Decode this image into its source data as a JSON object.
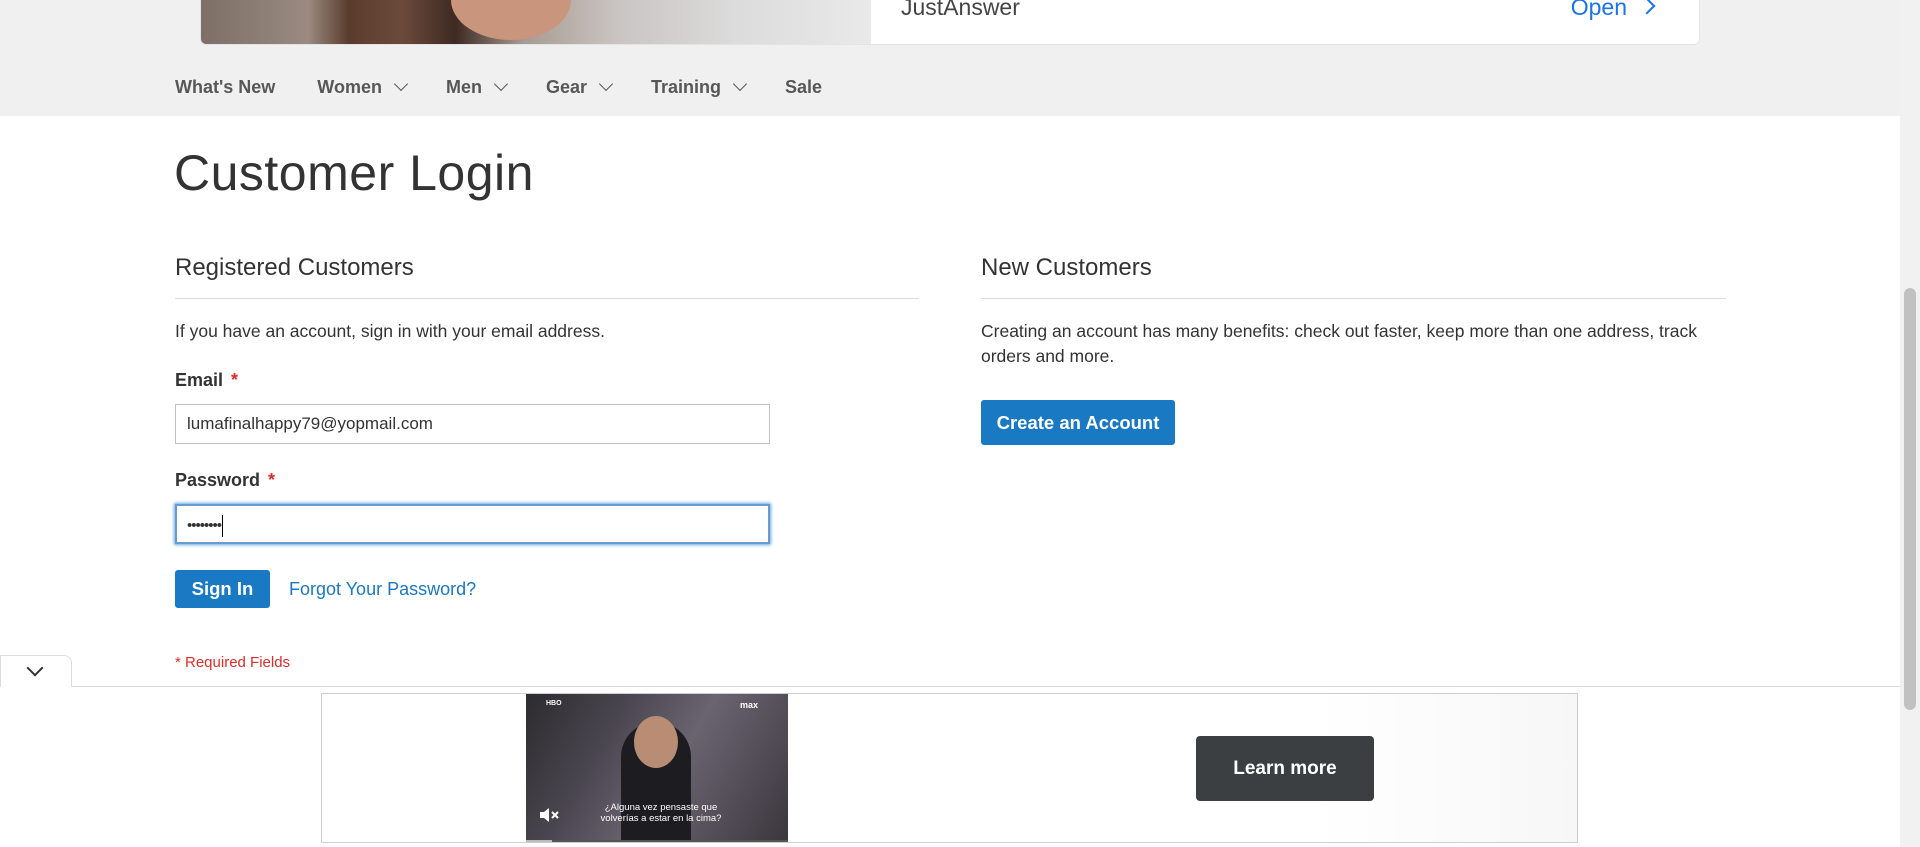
{
  "top_ad": {
    "brand": "JustAnswer",
    "cta": "Open"
  },
  "nav": {
    "items": [
      {
        "label": "What's New",
        "has_dropdown": false
      },
      {
        "label": "Women",
        "has_dropdown": true
      },
      {
        "label": "Men",
        "has_dropdown": true
      },
      {
        "label": "Gear",
        "has_dropdown": true
      },
      {
        "label": "Training",
        "has_dropdown": true
      },
      {
        "label": "Sale",
        "has_dropdown": false
      }
    ]
  },
  "page": {
    "title": "Customer Login"
  },
  "registered": {
    "title": "Registered Customers",
    "intro": "If you have an account, sign in with your email address.",
    "email_label": "Email",
    "email_value": "lumafinalhappy79@yopmail.com",
    "password_label": "Password",
    "password_value": "••••••••",
    "required_star": "*",
    "sign_in": "Sign In",
    "forgot": "Forgot Your Password?",
    "required_note": "* Required Fields"
  },
  "new_customers": {
    "title": "New Customers",
    "intro": "Creating an account has many benefits: check out faster, keep more than one address, track orders and more.",
    "create_account": "Create an Account"
  },
  "bottom_ad": {
    "video_logo": "HBO",
    "video_brand": "max",
    "video_caption": "¿Alguna vez pensaste que volverías a estar en la cima?",
    "cta": "Learn more",
    "progress": 0.1
  },
  "colors": {
    "primary": "#1979c3",
    "required": "#e02b27",
    "nav_bg": "#f0f0f0",
    "ad_link": "#1a73e8"
  },
  "icons": {
    "nav_dropdown": "chevron-down-icon",
    "collapse": "chevron-down-icon",
    "mute": "mute-icon",
    "ad_open": "chevron-right-icon"
  }
}
